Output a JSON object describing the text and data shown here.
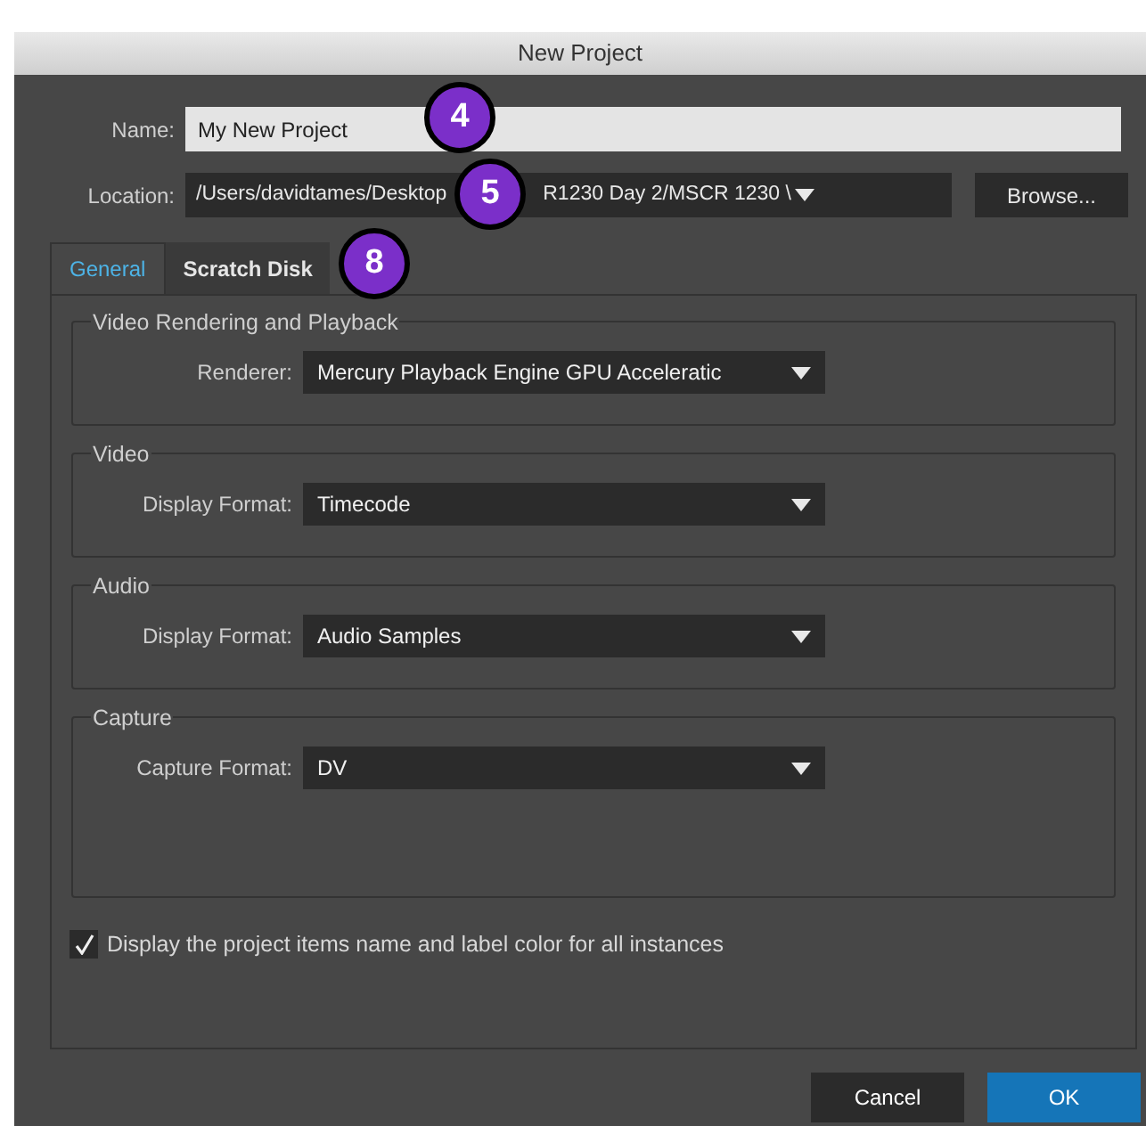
{
  "window": {
    "title": "New Project"
  },
  "name_field": {
    "label": "Name:",
    "value": "My New Project"
  },
  "location": {
    "label": "Location:",
    "value_parts": [
      "/Users/davidtames/Desktop",
      "R1230 Day 2/MSCR 1230 \\"
    ],
    "browse": "Browse..."
  },
  "tabs": [
    {
      "label": "General",
      "selected": true
    },
    {
      "label": "Scratch Disk",
      "selected": false
    }
  ],
  "groups": [
    {
      "title": "Video Rendering and Playback",
      "label": "Renderer:",
      "value": "Mercury Playback Engine GPU Acceleratic"
    },
    {
      "title": "Video",
      "label": "Display Format:",
      "value": "Timecode"
    },
    {
      "title": "Audio",
      "label": "Display Format:",
      "value": "Audio Samples"
    },
    {
      "title": "Capture",
      "label": "Capture Format:",
      "value": "DV"
    }
  ],
  "checkbox": {
    "label": "Display the project items name and label color for all instances",
    "checked": true
  },
  "buttons": [
    {
      "label": "Cancel",
      "kind": "secondary"
    },
    {
      "label": "OK",
      "kind": "primary"
    }
  ],
  "callouts": [
    {
      "number": "4"
    },
    {
      "number": "5"
    },
    {
      "number": "8"
    }
  ]
}
